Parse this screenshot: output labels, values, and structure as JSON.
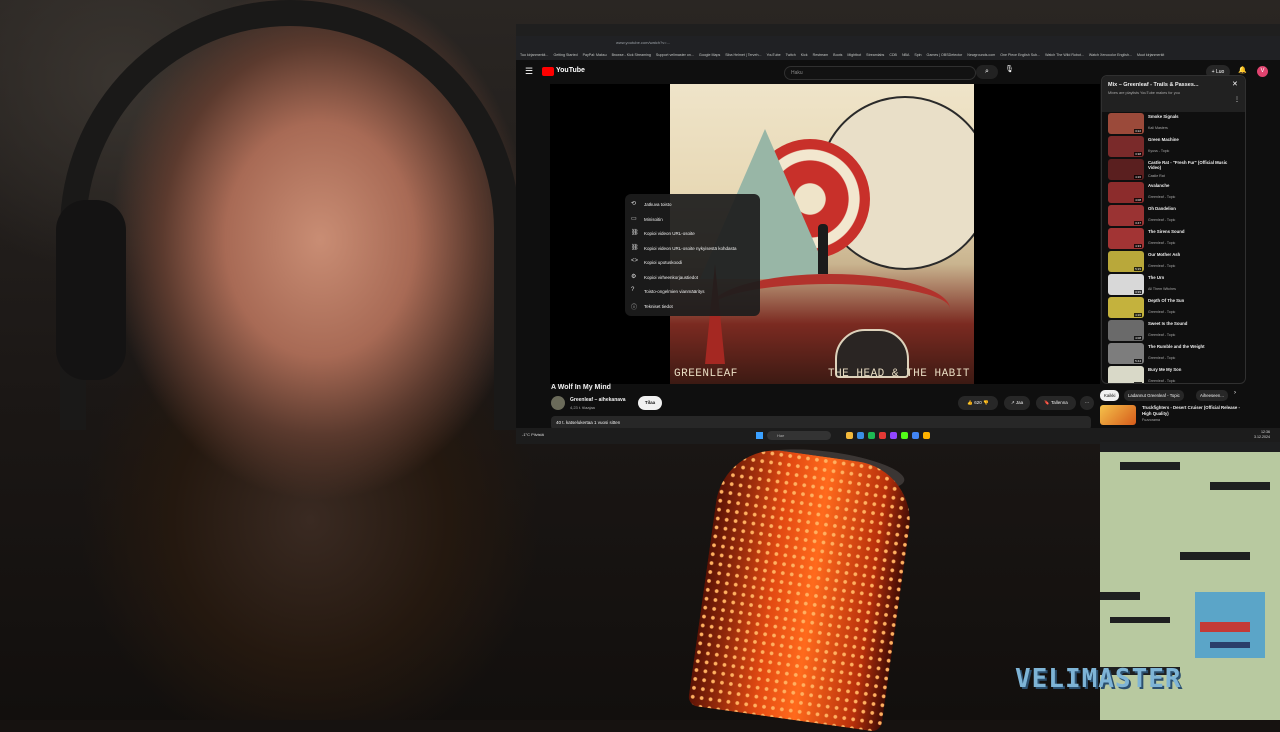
{
  "overlay": {
    "watermark": "VELIMASTER"
  },
  "browser": {
    "url": "www.youtube.com/watch?v=...",
    "bookmarks": [
      "Tuo kirjanmerkit...",
      "Getting Started",
      "PayPal: Maksu",
      "Browse - Kick Streaming",
      "Support velimaster on...",
      "Google Maps",
      "Siba Helmet | Terveh...",
      "YouTube",
      "Twitch",
      "Kick",
      "Restream",
      "Boots",
      "Mightbot",
      "Streamlabs",
      "CDB",
      "NBA",
      "Spin",
      "Games | OBSDetector",
      "Newgrounds.com",
      "One Piece English Sub...",
      "Watch The Wild Robot...",
      "Watch Xenocolor English...",
      "Muut kirjanmerkit"
    ]
  },
  "youtube": {
    "logo": "YouTube",
    "search_placeholder": "Haku",
    "create_label": "+ Luo",
    "avatar_letter": "V",
    "album_text_left": "GREENLEAF",
    "album_text_right": "THE HEAD & THE HABIT",
    "context_menu": [
      {
        "icon": "loop-icon",
        "glyph": "⟲",
        "label": "Jatkuva toisto"
      },
      {
        "icon": "miniplayer-icon",
        "glyph": "▭",
        "label": "Minisoitin"
      },
      {
        "icon": "link-icon",
        "glyph": "⛓",
        "label": "Kopioi videon URL-osoite"
      },
      {
        "icon": "link-time-icon",
        "glyph": "⛓",
        "label": "Kopioi videon URL-osoite nykyisestä kohdasta"
      },
      {
        "icon": "embed-icon",
        "glyph": "<>",
        "label": "Kopioi upotuskoodi"
      },
      {
        "icon": "debug-icon",
        "glyph": "⚙",
        "label": "Kopioi virheenkorjaustiedot"
      },
      {
        "icon": "troubleshoot-icon",
        "glyph": "?",
        "label": "Toisto-ongelmien vianmääritys"
      },
      {
        "icon": "info-icon",
        "glyph": "ⓘ",
        "label": "Tekniset tiedot"
      }
    ],
    "video_title": "A Wolf In My Mind",
    "channel_name": "Greenleaf – aihekanava",
    "channel_subs": "4,23 t. tilaajaa",
    "subscribe_label": "Tilaa",
    "like_count": "620",
    "share_label": "Jaa",
    "save_label": "Tallenna",
    "more_label": "⋯",
    "description_meta": "40 t. katselukertaa  1 vuosi sitten",
    "playlist": {
      "title": "Mix – Greenleaf - Trails & Passes...",
      "subtitle": "Mixes are playlists YouTube makes for you",
      "items": [
        {
          "title": "Smoke Signals",
          "artist": "Kali Masters",
          "duration": "3:22",
          "color": "#9b4a3a"
        },
        {
          "title": "Green Machine",
          "artist": "Kyuss - Topic",
          "duration": "3:38",
          "color": "#7a2a2a"
        },
        {
          "title": "Castle Rat - \"Fresh Fur\" (Official Music Video)",
          "artist": "Castle Rat",
          "duration": "4:26",
          "color": "#5a1f1f"
        },
        {
          "title": "Avalanche",
          "artist": "Greenleaf - Topic",
          "duration": "4:08",
          "color": "#8c2c2c"
        },
        {
          "title": "Oh Dandelion",
          "artist": "Greenleaf - Topic",
          "duration": "3:47",
          "color": "#9a3333"
        },
        {
          "title": "The Sirens Sound",
          "artist": "Greenleaf - Topic",
          "duration": "4:33",
          "color": "#a23434"
        },
        {
          "title": "Our Mother Ash",
          "artist": "Greenleaf - Topic",
          "duration": "5:15",
          "color": "#b9a83a"
        },
        {
          "title": "The Urn",
          "artist": "All Them Witches",
          "duration": "3:39",
          "color": "#d8d8d8"
        },
        {
          "title": "Depth Of The Sun",
          "artist": "Greenleaf - Topic",
          "duration": "4:26",
          "color": "#c4b23d"
        },
        {
          "title": "Sweet Is the Sound",
          "artist": "Greenleaf - Topic",
          "duration": "4:08",
          "color": "#6a6a6a"
        },
        {
          "title": "The Rumble and the Weight",
          "artist": "Greenleaf - Topic",
          "duration": "5:44",
          "color": "#7d7d7d"
        },
        {
          "title": "Bury Me My Son",
          "artist": "Greenleaf - Topic",
          "duration": "4:12",
          "color": "#d9d9c8"
        }
      ]
    },
    "chips": [
      "Kaikki",
      "Ladannut Greenleaf - Topic",
      "Aiheeseen..."
    ],
    "recommended": {
      "title": "Truckfighters - Desert Cruiser (Official Release - High Quality)",
      "channel": "Fuzzorama"
    }
  },
  "taskbar": {
    "weather": "-1°C Pilvistä",
    "search_placeholder": "Hae",
    "time": "12:36",
    "date": "3.12.2024",
    "apps": [
      "#f3b93c",
      "#3a8ee6",
      "#1db954",
      "#e53935",
      "#9146ff",
      "#53fc18",
      "#4285f4",
      "#ffb300"
    ]
  }
}
